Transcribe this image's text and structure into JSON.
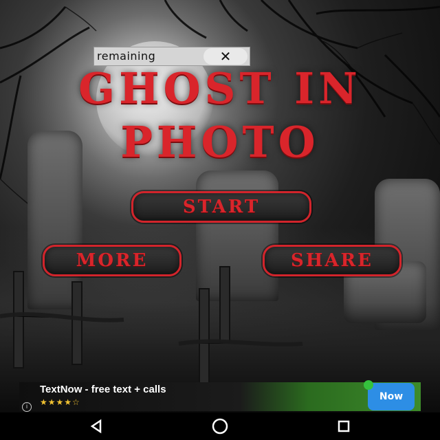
{
  "overlay": {
    "remaining_label": "remaining",
    "close_glyph": "✕"
  },
  "title": {
    "line1": "GHOST IN",
    "line2": "PHOTO"
  },
  "menu": {
    "start_label": "START",
    "more_label": "MORE",
    "share_label": "SHARE"
  },
  "ad": {
    "title": "TextNow - free text + calls",
    "rating_stars": "★★★★☆",
    "info_glyph": "i",
    "logo_text": "Now"
  },
  "navbar": {
    "back_icon": "back-triangle-icon",
    "home_icon": "home-circle-icon",
    "recents_icon": "recents-square-icon"
  },
  "colors": {
    "accent_red": "#d9252b",
    "button_border": "#d2242b",
    "ad_green": "#3d8b2a"
  }
}
